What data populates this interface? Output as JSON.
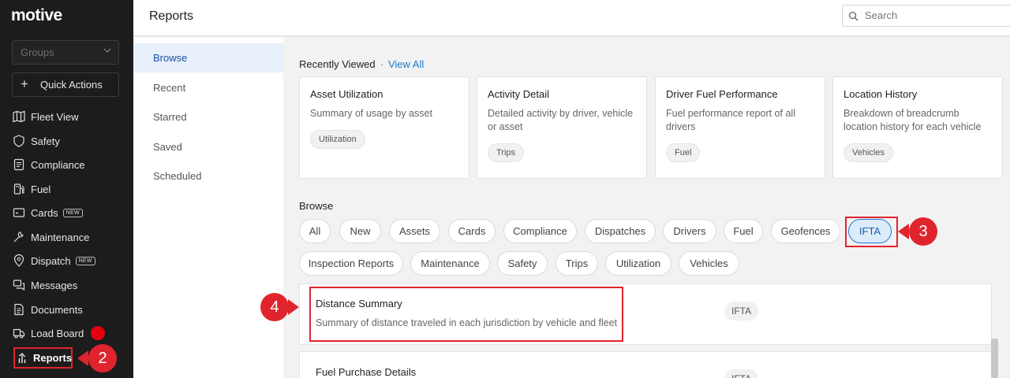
{
  "sidebar": {
    "logo": "motive",
    "groups_placeholder": "Groups",
    "quick_actions": "Quick Actions",
    "items": [
      {
        "label": "Fleet View",
        "icon": "map-icon"
      },
      {
        "label": "Safety",
        "icon": "shield-icon"
      },
      {
        "label": "Compliance",
        "icon": "clipboard-icon"
      },
      {
        "label": "Fuel",
        "icon": "fuel-pump-icon"
      },
      {
        "label": "Cards",
        "icon": "card-icon",
        "badge": "NEW"
      },
      {
        "label": "Maintenance",
        "icon": "wrench-icon"
      },
      {
        "label": "Dispatch",
        "icon": "location-pin-icon",
        "badge": "NEW"
      },
      {
        "label": "Messages",
        "icon": "chat-icon"
      },
      {
        "label": "Documents",
        "icon": "document-icon"
      },
      {
        "label": "Load Board",
        "icon": "truck-icon"
      },
      {
        "label": "Reports",
        "icon": "reports-icon",
        "active": true
      }
    ]
  },
  "header": {
    "title": "Reports",
    "search_placeholder": "Search"
  },
  "subnav": {
    "items": [
      "Browse",
      "Recent",
      "Starred",
      "Saved",
      "Scheduled"
    ],
    "active": "Browse"
  },
  "recently_viewed": {
    "label": "Recently Viewed",
    "separator": "·",
    "view_all": "View All",
    "cards": [
      {
        "title": "Asset Utilization",
        "desc": "Summary of usage by asset",
        "tag": "Utilization"
      },
      {
        "title": "Activity Detail",
        "desc": "Detailed activity by driver, vehicle or asset",
        "tag": "Trips"
      },
      {
        "title": "Driver Fuel Performance",
        "desc": "Fuel performance report of all drivers",
        "tag": "Fuel"
      },
      {
        "title": "Location History",
        "desc": "Breakdown of breadcrumb location history for each vehicle",
        "tag": "Vehicles"
      }
    ]
  },
  "browse": {
    "label": "Browse",
    "chips": [
      "All",
      "New",
      "Assets",
      "Cards",
      "Compliance",
      "Dispatches",
      "Drivers",
      "Fuel",
      "Geofences",
      "IFTA",
      "Inspection Reports",
      "Maintenance",
      "Safety",
      "Trips",
      "Utilization",
      "Vehicles"
    ],
    "active_chip": "IFTA"
  },
  "report_list": [
    {
      "title": "Distance Summary",
      "desc": "Summary of distance traveled in each jurisdiction by vehicle and fleet",
      "tag": "IFTA"
    },
    {
      "title": "Fuel Purchase Details",
      "desc": "",
      "tag": "IFTA"
    }
  ],
  "callouts": [
    "2",
    "3",
    "4"
  ],
  "colors": {
    "sidebar_bg": "#1c1c1c",
    "accent": "#1a7bd6",
    "highlight": "#e0242e"
  }
}
